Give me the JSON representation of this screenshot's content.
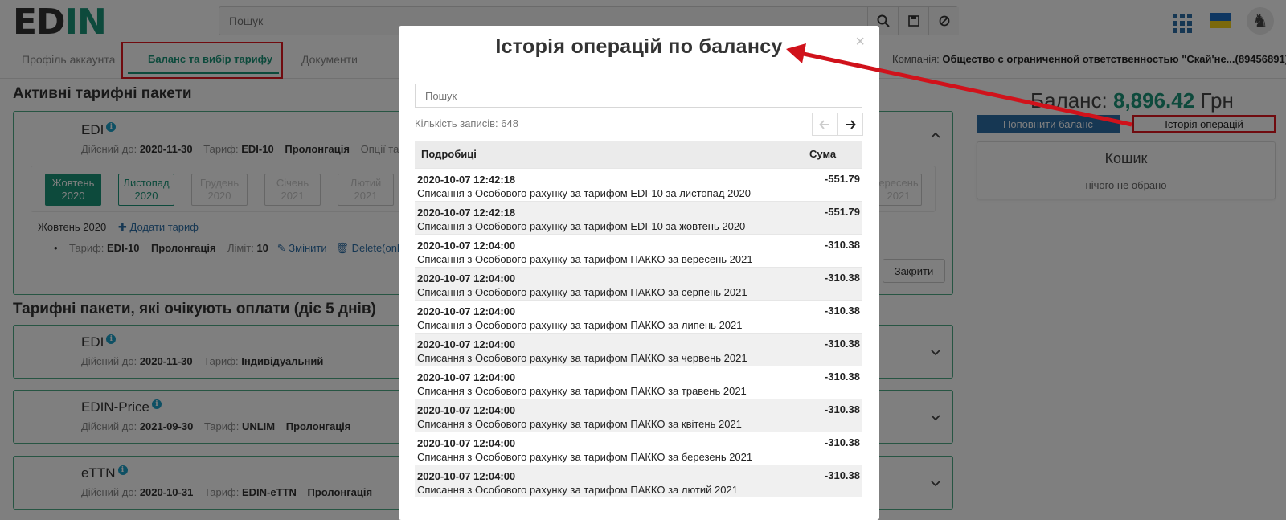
{
  "header": {
    "search_placeholder": "Пошук"
  },
  "tabs": [
    {
      "label": "Профіль аккаунта"
    },
    {
      "label": "Баланс та вибір тарифу"
    },
    {
      "label": "Документи"
    }
  ],
  "company": {
    "label": "Компанія:",
    "name": "Общество с ограниченной ответственностью \"Скай'не...(89456891)"
  },
  "active_section": {
    "title": "Активні тарифні пакети",
    "package": {
      "name": "EDI",
      "valid_label": "Дійсний до:",
      "valid_date": "2020-11-30",
      "tariff_label": "Тариф:",
      "tariff": "EDI-10",
      "prolong": "Пролонгація",
      "options": "Опції тари"
    },
    "months": [
      {
        "line1": "Жовтень",
        "line2": "2020"
      },
      {
        "line1": "Листопад",
        "line2": "2020"
      },
      {
        "line1": "Грудень",
        "line2": "2020"
      },
      {
        "line1": "Січень",
        "line2": "2021"
      },
      {
        "line1": "Лютий",
        "line2": "2021"
      },
      {
        "line1": "ересень",
        "line2": "2021"
      }
    ],
    "selected_month": "Жовтень 2020",
    "add_tariff": "Додати тариф",
    "item": {
      "tariff_label": "Тариф:",
      "tariff": "EDI-10",
      "prolong": "Пролонгація",
      "limit_label": "Ліміт:",
      "limit": "10",
      "change": "Змінити",
      "delete": "Delete(only for"
    },
    "close_label": "Закрити"
  },
  "pending_section": {
    "title": "Тарифні пакети, які очікують оплати (діє 5 днів)",
    "packages": [
      {
        "name": "EDI",
        "valid_label": "Дійсний до:",
        "valid_date": "2020-11-30",
        "tariff_label": "Тариф:",
        "tariff": "Індивідуальний",
        "prolong": ""
      },
      {
        "name": "EDIN-Price",
        "valid_label": "Дійсний до:",
        "valid_date": "2021-09-30",
        "tariff_label": "Тариф:",
        "tariff": "UNLIM",
        "prolong": "Пролонгація"
      },
      {
        "name": "eTTN",
        "valid_label": "Дійсний до:",
        "valid_date": "2020-10-31",
        "tariff_label": "Тариф:",
        "tariff": "EDIN-eTTN",
        "prolong": "Пролонгація"
      }
    ]
  },
  "balance": {
    "label": "Баланс:",
    "amount": "8,896.42",
    "currency": "Грн",
    "topup_label": "Поповнити баланс",
    "history_label": "Історія операцій"
  },
  "cart": {
    "title": "Кошик",
    "empty": "нічого не обрано"
  },
  "modal": {
    "title": "Історія операцій по балансу",
    "close_symbol": "×",
    "search_placeholder": "Пошук",
    "count_text": "Кількість записів: 648",
    "col_details": "Подробиці",
    "col_sum": "Сума",
    "rows": [
      {
        "date": "2020-10-07 12:42:18",
        "desc": "Списання з Особового рахунку за тарифом EDI-10 за листопад 2020",
        "sum": "-551.79"
      },
      {
        "date": "2020-10-07 12:42:18",
        "desc": "Списання з Особового рахунку за тарифом EDI-10 за жовтень 2020",
        "sum": "-551.79"
      },
      {
        "date": "2020-10-07 12:04:00",
        "desc": "Списання з Особового рахунку за тарифом ПАККО за вересень 2021",
        "sum": "-310.38"
      },
      {
        "date": "2020-10-07 12:04:00",
        "desc": "Списання з Особового рахунку за тарифом ПАККО за серпень 2021",
        "sum": "-310.38"
      },
      {
        "date": "2020-10-07 12:04:00",
        "desc": "Списання з Особового рахунку за тарифом ПАККО за липень 2021",
        "sum": "-310.38"
      },
      {
        "date": "2020-10-07 12:04:00",
        "desc": "Списання з Особового рахунку за тарифом ПАККО за червень 2021",
        "sum": "-310.38"
      },
      {
        "date": "2020-10-07 12:04:00",
        "desc": "Списання з Особового рахунку за тарифом ПАККО за травень 2021",
        "sum": "-310.38"
      },
      {
        "date": "2020-10-07 12:04:00",
        "desc": "Списання з Особового рахунку за тарифом ПАККО за квітень 2021",
        "sum": "-310.38"
      },
      {
        "date": "2020-10-07 12:04:00",
        "desc": "Списання з Особового рахунку за тарифом ПАККО за березень 2021",
        "sum": "-310.38"
      },
      {
        "date": "2020-10-07 12:04:00",
        "desc": "Списання з Особового рахунку за тарифом ПАККО за лютий 2021",
        "sum": "-310.38"
      }
    ]
  },
  "colors": {
    "brand": "#1a9478",
    "highlight": "#e0161e",
    "primary": "#2d6ea6"
  }
}
